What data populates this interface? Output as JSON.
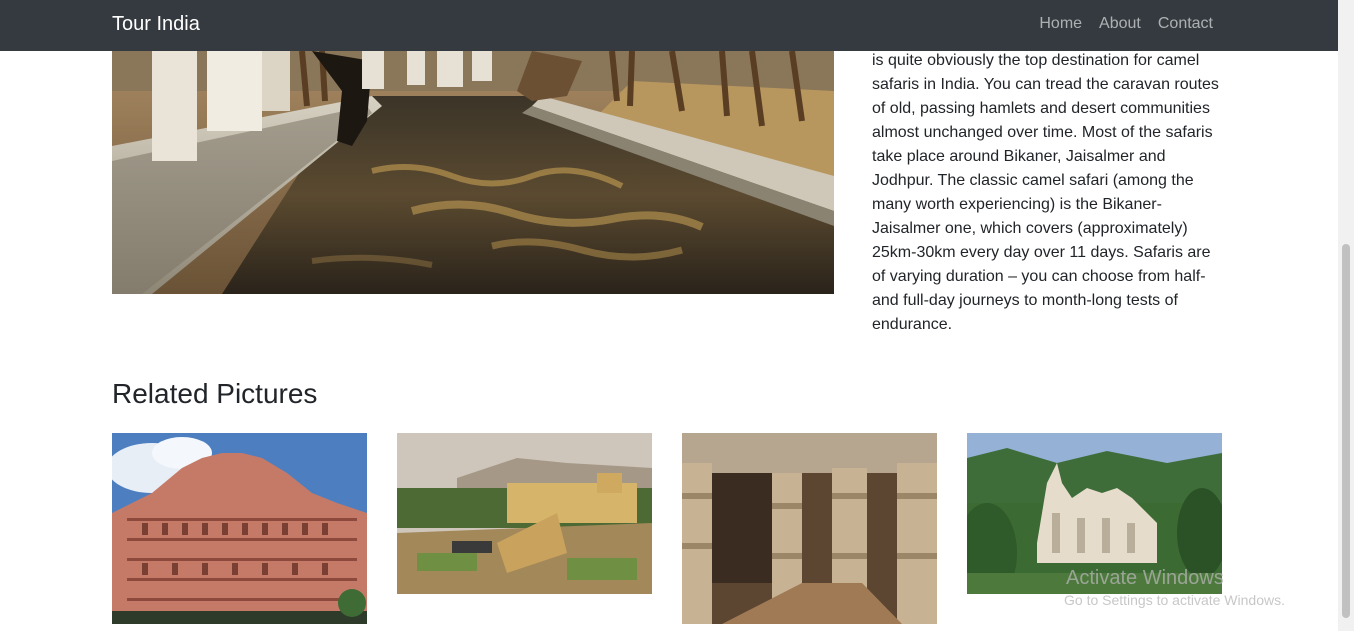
{
  "navbar": {
    "brand": "Tour India",
    "links": [
      {
        "label": "Home"
      },
      {
        "label": "About"
      },
      {
        "label": "Contact"
      }
    ]
  },
  "article": {
    "text": "is quite obviously the top destination for camel safaris in India. You can tread the caravan routes of old, passing hamlets and desert communities almost unchanged over time. Most of the safaris take place around Bikaner, Jaisalmer and Jodhpur. The classic camel safari (among the many worth experiencing) is the Bikaner-Jaisalmer one, which covers (approximately) 25km-30km every day over 11 days. Safaris are of varying duration – you can choose from half- and full-day journeys to month-long tests of endurance."
  },
  "related": {
    "title": "Related Pictures"
  },
  "watermark": {
    "title": "Activate Windows",
    "subtitle": "Go to Settings to activate Windows."
  },
  "colors": {
    "navbar": "#343a40",
    "text": "#212529",
    "nav_link": "rgba(255,255,255,0.6)"
  }
}
